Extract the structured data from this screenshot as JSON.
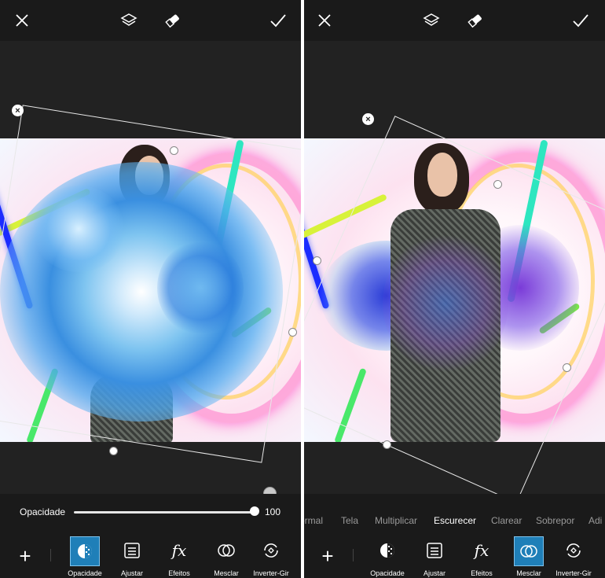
{
  "left_screen": {
    "top_bar": {
      "icons": [
        "close-icon",
        "layers-icon",
        "eraser-icon",
        "check-icon"
      ]
    },
    "opacity_slider": {
      "label": "Opacidade",
      "value": "100",
      "level": 1.0
    },
    "toolbar": {
      "add_symbol": "+",
      "tools": [
        {
          "label": "Opacidade",
          "icon": "opacity-icon",
          "active": true
        },
        {
          "label": "Ajustar",
          "icon": "adjust-icon",
          "active": false
        },
        {
          "label": "Efeitos",
          "icon": "fx-icon",
          "active": false
        },
        {
          "label": "Mesclar",
          "icon": "blend-icon",
          "active": false
        },
        {
          "label": "Inverter-Gir",
          "icon": "flip-rotate-icon",
          "active": false
        }
      ]
    }
  },
  "right_screen": {
    "top_bar": {
      "icons": [
        "close-icon",
        "layers-icon",
        "eraser-icon",
        "check-icon"
      ]
    },
    "blend_modes": {
      "items": [
        "ormal",
        "Tela",
        "Multiplicar",
        "Escurecer",
        "Clarear",
        "Sobrepor",
        "Adi"
      ],
      "selected": "Escurecer"
    },
    "toolbar": {
      "add_symbol": "+",
      "tools": [
        {
          "label": "Opacidade",
          "icon": "opacity-icon",
          "active": false
        },
        {
          "label": "Ajustar",
          "icon": "adjust-icon",
          "active": false
        },
        {
          "label": "Efeitos",
          "icon": "fx-icon",
          "active": false
        },
        {
          "label": "Mesclar",
          "icon": "blend-icon",
          "active": true
        },
        {
          "label": "Inverter-Gir",
          "icon": "flip-rotate-icon",
          "active": false
        }
      ]
    }
  },
  "colors": {
    "accent": "#1f7fb8",
    "background": "#1a1a1a",
    "workspace": "#222222"
  }
}
